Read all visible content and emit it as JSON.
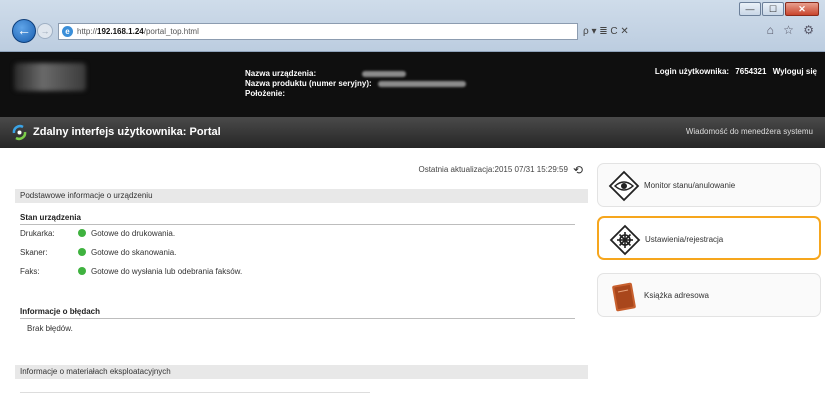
{
  "browser": {
    "url_prefix": "http://",
    "url_host": "192.168.1.24",
    "url_path": "/portal_top.html",
    "address_tools": "ρ ▾ ≣ C ✕",
    "nav_icons": "⌂ ☆ ⚙",
    "window_min": "—",
    "window_max": "☐",
    "window_close": "✕"
  },
  "header": {
    "device_name_label": "Nazwa urządzenia:",
    "product_name_label": "Nazwa produktu (numer seryjny):",
    "location_label": "Położenie:",
    "login_label": "Login użytkownika:",
    "login_value": "7654321",
    "logout_label": "Wyloguj się"
  },
  "portal": {
    "title": "Zdalny interfejs użytkownika: Portal",
    "system_message": "Wiadomość do menedżera systemu"
  },
  "main": {
    "last_update": "Ostatnia aktualizacja:2015 07/31 15:29:59",
    "basic_info_header": "Podstawowe informacje o urządzeniu",
    "device_status_title": "Stan urządzenia",
    "status_rows": [
      {
        "label": "Drukarka:",
        "value": "Gotowe do drukowania."
      },
      {
        "label": "Skaner:",
        "value": "Gotowe do skanowania."
      },
      {
        "label": "Faks:",
        "value": "Gotowe do wysłania lub odebrania faksów."
      }
    ],
    "error_info_title": "Informacje o błędach",
    "error_text": "Brak błędów.",
    "consumables_header": "Informacje o materiałach eksploatacyjnych"
  },
  "panel": {
    "monitor_label": "Monitor stanu/anulowanie",
    "settings_label": "Ustawienia/rejestracja",
    "addressbook_label": "Książka adresowa"
  },
  "colors": {
    "status_ok": "#3fb23f",
    "active_border": "#f6a61d",
    "header_bg": "#0f0f0f"
  }
}
